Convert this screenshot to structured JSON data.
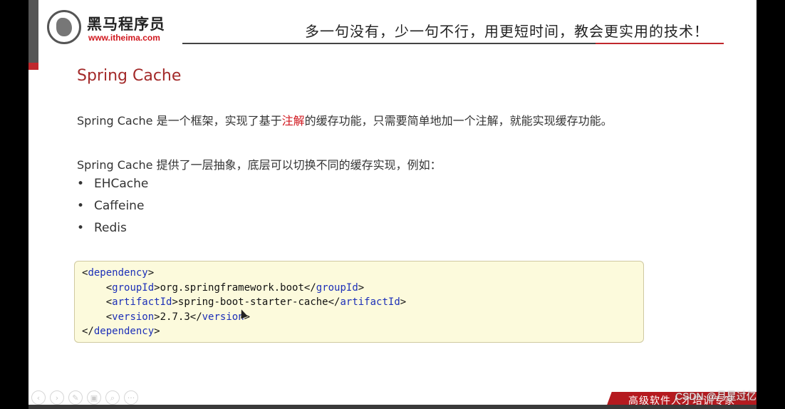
{
  "brand": {
    "name_cn": "黑马程序员",
    "url": "www.itheima.com"
  },
  "slogan": "多一句没有，少一句不行，用更短时间，教会更实用的技术！",
  "slide": {
    "title": "Spring Cache",
    "para1": {
      "before": "Spring Cache 是一个框架，实现了基于",
      "highlight": "注解",
      "after": "的缓存功能，只需要简单地加一个注解，就能实现缓存功能。"
    },
    "para2": "Spring Cache 提供了一层抽象，底层可以切换不同的缓存实现，例如：",
    "bullets": [
      "EHCache",
      "Caffeine",
      "Redis"
    ],
    "code": {
      "l1_open": "<",
      "l1_tag": "dependency",
      "l1_close": ">",
      "l2_indent": "    ",
      "l2_tag": "groupId",
      "l2_val": "org.springframework.boot",
      "l3_indent": "    ",
      "l3_tag": "artifactId",
      "l3_val": "spring-boot-starter-cache",
      "l4_indent": "    ",
      "l4_tag": "version",
      "l4_val": "2.7.3",
      "l5_tag": "dependency"
    }
  },
  "controls": [
    "‹",
    "›",
    "✎",
    "▣",
    "⌕",
    "···"
  ],
  "footer": {
    "text": "高级软件人才培训专家",
    "watermark": "CSDN @月星过亿"
  },
  "colors": {
    "accent_red": "#c0282d",
    "title_red": "#a32a2a",
    "code_bg": "#fcfadc",
    "tag_blue": "#1c2fb8"
  }
}
